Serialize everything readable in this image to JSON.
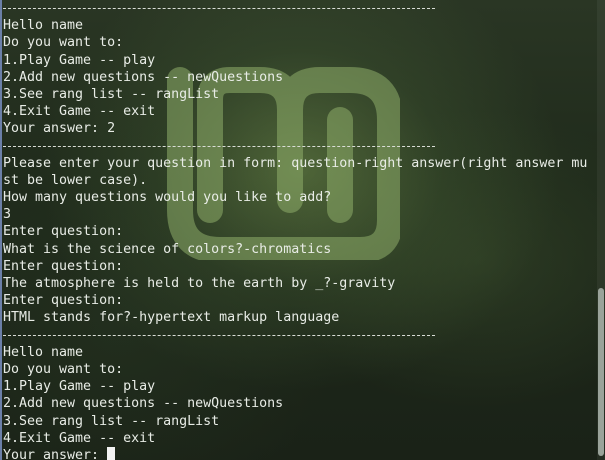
{
  "terminal": {
    "lines": [
      {
        "type": "sep"
      },
      {
        "type": "text",
        "text": "Hello name"
      },
      {
        "type": "text",
        "text": "Do you want to:"
      },
      {
        "type": "text",
        "text": "1.Play Game -- play"
      },
      {
        "type": "text",
        "text": "2.Add new questions -- newQuestions"
      },
      {
        "type": "text",
        "text": "3.See rang list -- rangList"
      },
      {
        "type": "text",
        "text": "4.Exit Game -- exit"
      },
      {
        "type": "text",
        "text": "Your answer: 2"
      },
      {
        "type": "sep"
      },
      {
        "type": "text",
        "text": "Please enter your question in form: question-right answer(right answer mu"
      },
      {
        "type": "text",
        "text": "st be lower case)."
      },
      {
        "type": "text",
        "text": "How many questions would you like to add?"
      },
      {
        "type": "text",
        "text": "3"
      },
      {
        "type": "text",
        "text": "Enter question:"
      },
      {
        "type": "text",
        "text": "What is the science of colors?-chromatics"
      },
      {
        "type": "text",
        "text": "Enter question:"
      },
      {
        "type": "text",
        "text": "The atmosphere is held to the earth by _?-gravity"
      },
      {
        "type": "text",
        "text": "Enter question:"
      },
      {
        "type": "text",
        "text": "HTML stands for?-hypertext markup language"
      },
      {
        "type": "sep"
      },
      {
        "type": "text",
        "text": "Hello name"
      },
      {
        "type": "text",
        "text": "Do you want to:"
      },
      {
        "type": "text",
        "text": "1.Play Game -- play"
      },
      {
        "type": "text",
        "text": "2.Add new questions -- newQuestions"
      },
      {
        "type": "text",
        "text": "3.See rang list -- rangList"
      },
      {
        "type": "text",
        "text": "4.Exit Game -- exit"
      },
      {
        "type": "prompt",
        "text": "Your answer: "
      }
    ],
    "colors": {
      "text": "#e8ece6",
      "background": "#1f2a1b",
      "cursor": "#f2f2f2"
    }
  }
}
